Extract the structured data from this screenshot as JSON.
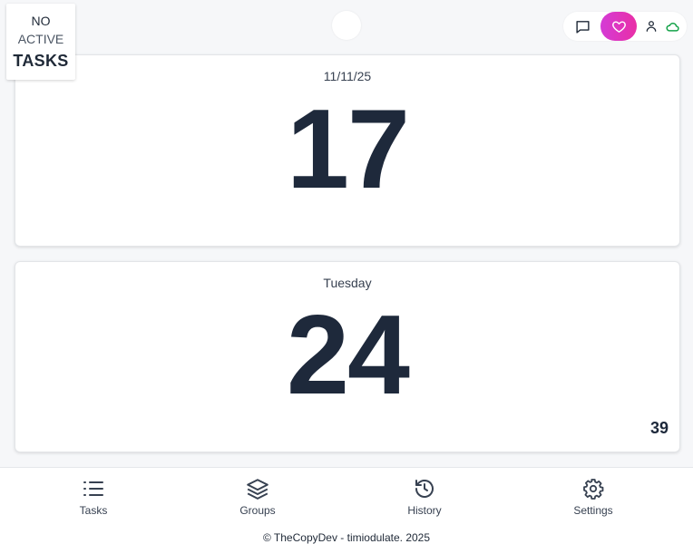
{
  "task_status": {
    "line1": "NO",
    "line2": "ACTIVE",
    "line3": "TASKS"
  },
  "toolbar": {
    "icons": [
      "message-icon",
      "heart-icon",
      "user-icon",
      "cloud-icon"
    ],
    "heart_gradient": [
      "#d43bd6",
      "#e92fa6"
    ],
    "cloud_color": "#16a34a"
  },
  "date_card": {
    "date": "11/11/25",
    "day_of_month": "17"
  },
  "time_card": {
    "weekday": "Tuesday",
    "value": "24",
    "seconds": "39"
  },
  "nav": {
    "tasks": "Tasks",
    "groups": "Groups",
    "history": "History",
    "settings": "Settings"
  },
  "footer": {
    "text": "© TheCopyDev - timiodulate. 2025"
  },
  "colors": {
    "background": "#f6f7f9",
    "numeral": "#1e293b"
  }
}
